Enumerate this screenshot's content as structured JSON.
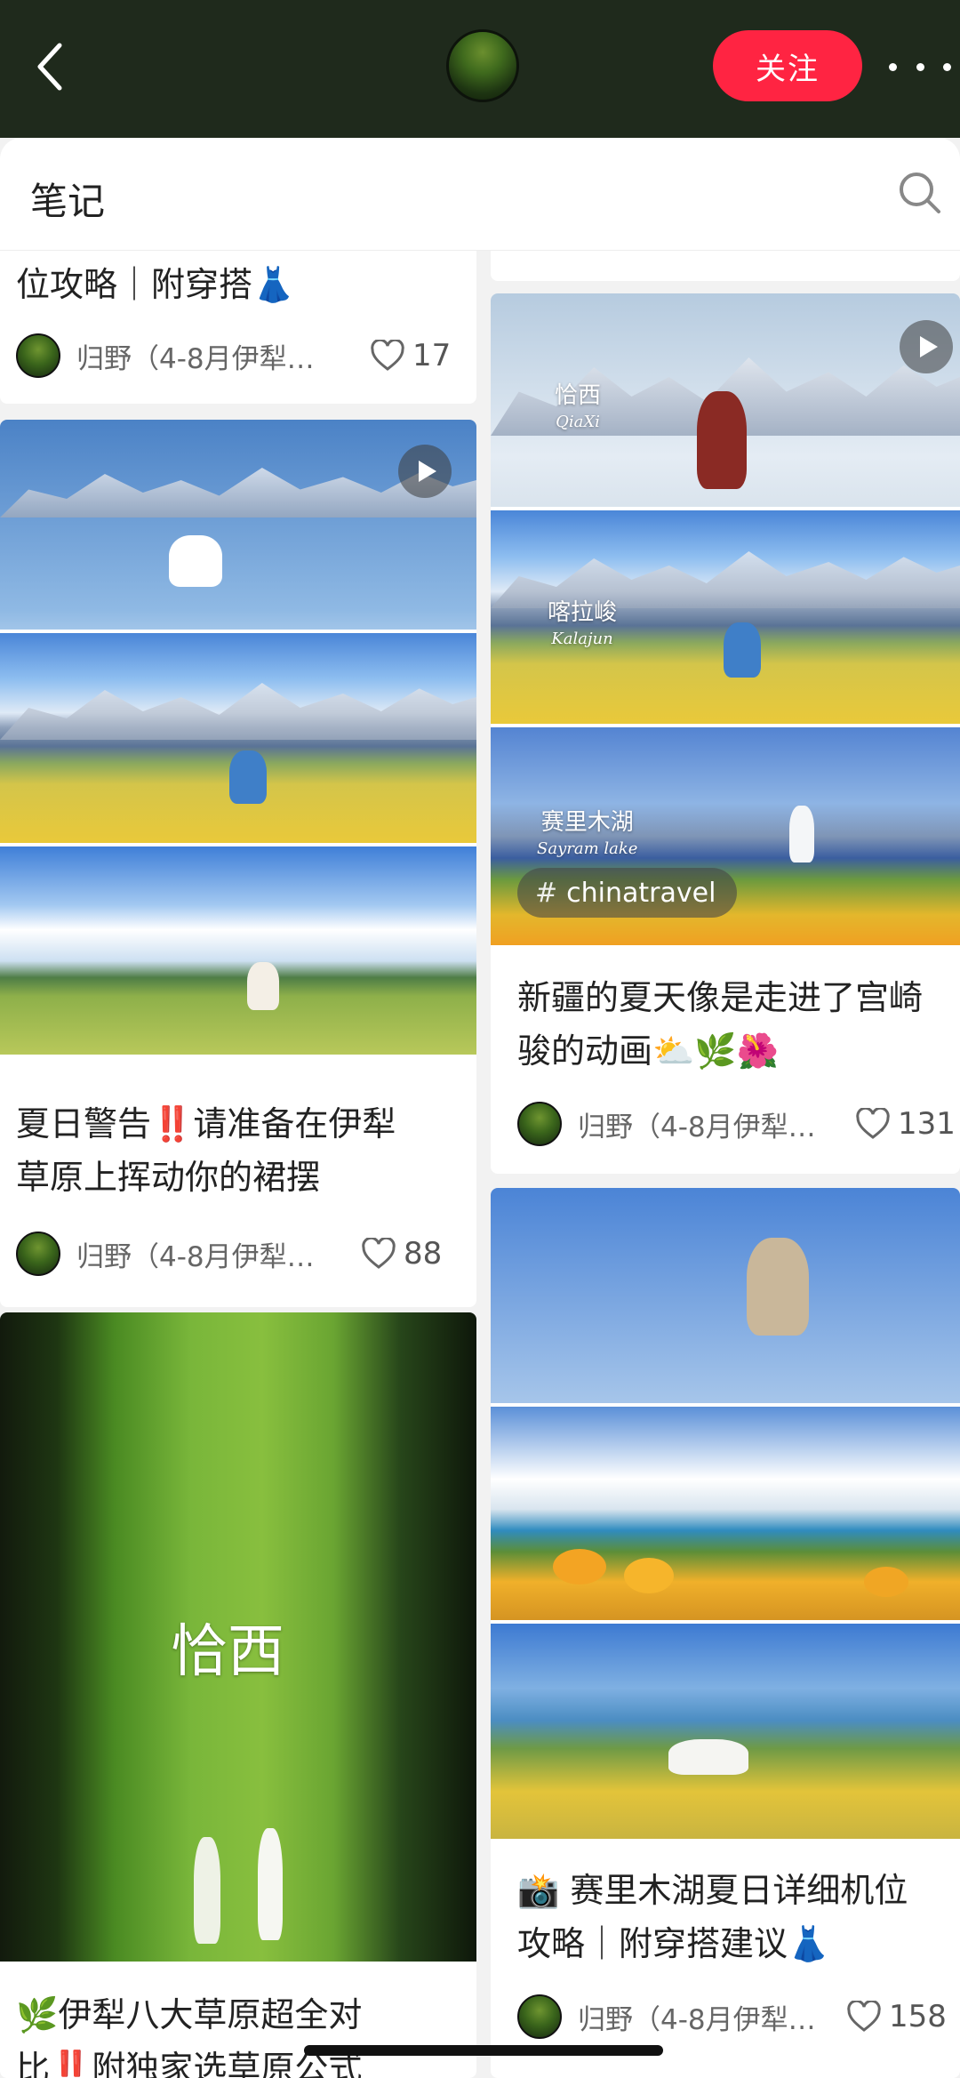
{
  "header": {
    "follow_label": "关注"
  },
  "tabs": {
    "notes_label": "笔记"
  },
  "left_column": [
    {
      "title": "位攻略｜附穿搭👗",
      "author": "归野（4-8月伊犁…",
      "likes": "17"
    },
    {
      "title_line1": "夏日警告‼️请准备在伊犁",
      "title_line2": "草原上挥动你的裙摆",
      "author": "归野（4-8月伊犁…",
      "likes": "88",
      "has_video": true
    },
    {
      "overlay_text": "恰西",
      "title_line1": "🌿伊犁八大草原超全对",
      "title_line2": "比‼️附独家选草原公式"
    }
  ],
  "right_column": [
    {
      "overlay_top": "恰西",
      "overlay_top_en": "QiaXi",
      "overlay_mid": "喀拉峻",
      "overlay_mid_en": "Kalajun",
      "overlay_bot": "赛里木湖",
      "overlay_bot_en": "Sayram lake",
      "tag": "chinatravel",
      "title_line1": "新疆的夏天像是走进了宫崎",
      "title_line2": "骏的动画⛅🌿🌺",
      "author": "归野（4-8月伊犁…",
      "likes": "131",
      "has_video": true
    },
    {
      "title_line1": "📸 赛里木湖夏日详细机位",
      "title_line2": "攻略｜附穿搭建议👗",
      "author": "归野（4-8月伊犁…",
      "likes": "158"
    }
  ],
  "colors": {
    "accent": "#ff2442",
    "header_bg": "#1f2a1c"
  }
}
